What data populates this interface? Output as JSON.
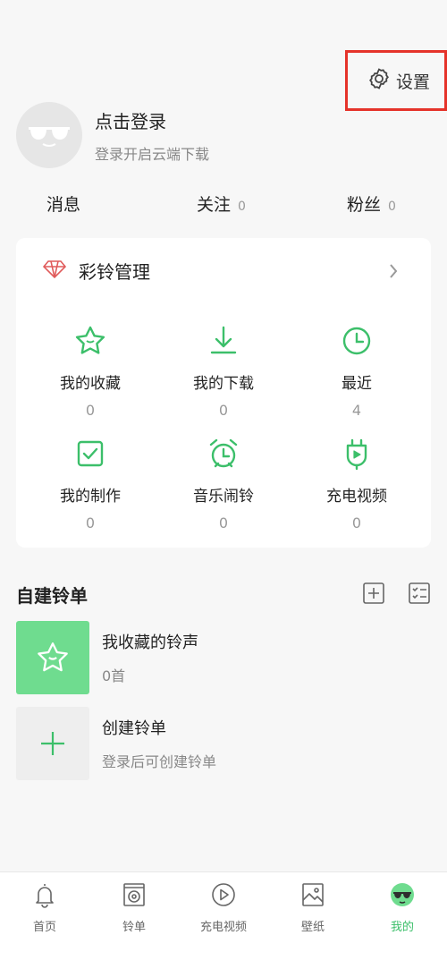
{
  "header": {
    "settings_label": "设置"
  },
  "profile": {
    "title": "点击登录",
    "subtitle": "登录开启云端下载"
  },
  "stats": [
    {
      "label": "消息",
      "count": ""
    },
    {
      "label": "关注",
      "count": "0"
    },
    {
      "label": "粉丝",
      "count": "0"
    }
  ],
  "ringtone_manage": {
    "title": "彩铃管理",
    "items": [
      {
        "label": "我的收藏",
        "count": "0",
        "icon": "star-icon"
      },
      {
        "label": "我的下载",
        "count": "0",
        "icon": "download-icon"
      },
      {
        "label": "最近",
        "count": "4",
        "icon": "clock-icon"
      },
      {
        "label": "我的制作",
        "count": "0",
        "icon": "checkbox-icon"
      },
      {
        "label": "音乐闹铃",
        "count": "0",
        "icon": "alarm-clock-icon"
      },
      {
        "label": "充电视频",
        "count": "0",
        "icon": "charging-video-icon"
      }
    ]
  },
  "playlists": {
    "title": "自建铃单",
    "items": [
      {
        "name": "我收藏的铃声",
        "sub": "0首"
      },
      {
        "name": "创建铃单",
        "sub": "登录后可创建铃单"
      }
    ]
  },
  "tabs": [
    {
      "label": "首页",
      "icon": "bell-icon"
    },
    {
      "label": "铃单",
      "icon": "playlist-icon"
    },
    {
      "label": "充电视频",
      "icon": "play-icon"
    },
    {
      "label": "壁纸",
      "icon": "wallpaper-icon"
    },
    {
      "label": "我的",
      "icon": "profile-icon",
      "active": true
    }
  ],
  "colors": {
    "accent": "#3cbf6a",
    "highlight_box": "#e5332a",
    "favorite_thumb": "#6fdc8f",
    "diamond": "#e05a5a"
  }
}
